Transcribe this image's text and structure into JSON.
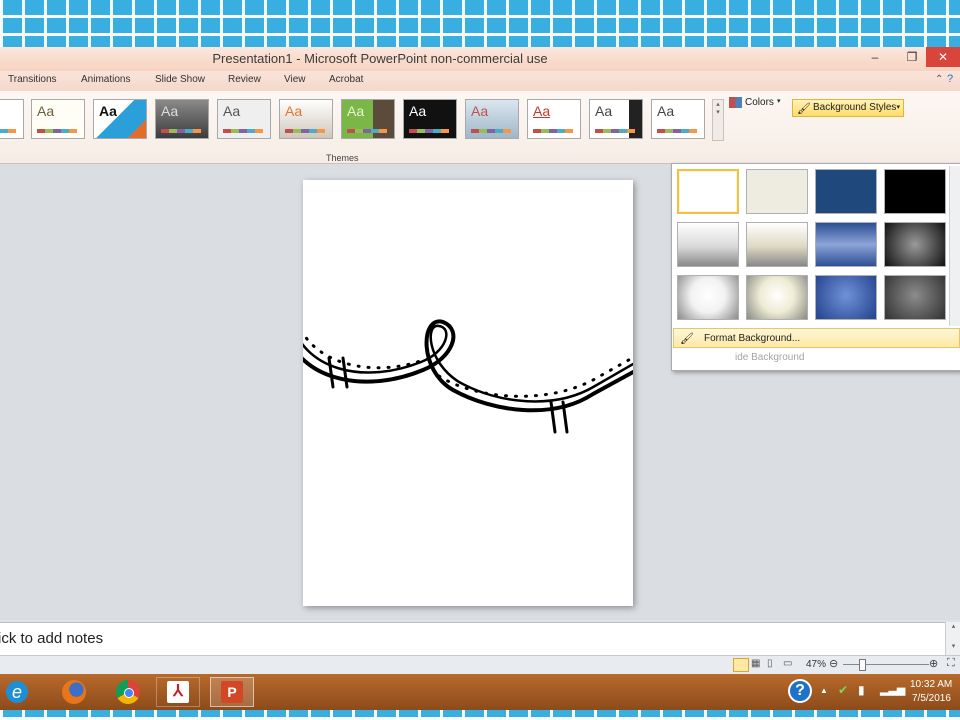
{
  "window": {
    "title": "Presentation1 - Microsoft PowerPoint non-commercial use",
    "controls": {
      "minimize": "–",
      "restore": "❐",
      "close": "✕"
    }
  },
  "ribbon": {
    "tabs": [
      "Transitions",
      "Animations",
      "Slide Show",
      "Review",
      "View",
      "Acrobat"
    ],
    "themes_group_label": "Themes",
    "theme_sample_text": "Aa",
    "colors_label": "Colors",
    "background_styles_label": "Background Styles"
  },
  "background_menu": {
    "swatch_colors": [
      "#ffffff",
      "#eeece1",
      "#1f497d",
      "#000000",
      "#d9d9d9",
      "#ddd9c3",
      "#4f6fb0",
      "#404040",
      "#f2f2f2",
      "#eeecd4",
      "#3a5ca8",
      "#6b6b6b"
    ],
    "format_background_label": "Format Background...",
    "reset_background_label": "ide Background"
  },
  "notes": {
    "placeholder": "ick to add notes"
  },
  "status": {
    "zoom": "47%"
  },
  "taskbar": {
    "apps": [
      "ie-icon",
      "firefox-icon",
      "chrome-icon",
      "acrobat-icon",
      "powerpoint-icon"
    ],
    "time": "10:32 AM",
    "date": "7/5/2016"
  },
  "slide": {
    "arrow_fill_color": "#5b2a86"
  }
}
